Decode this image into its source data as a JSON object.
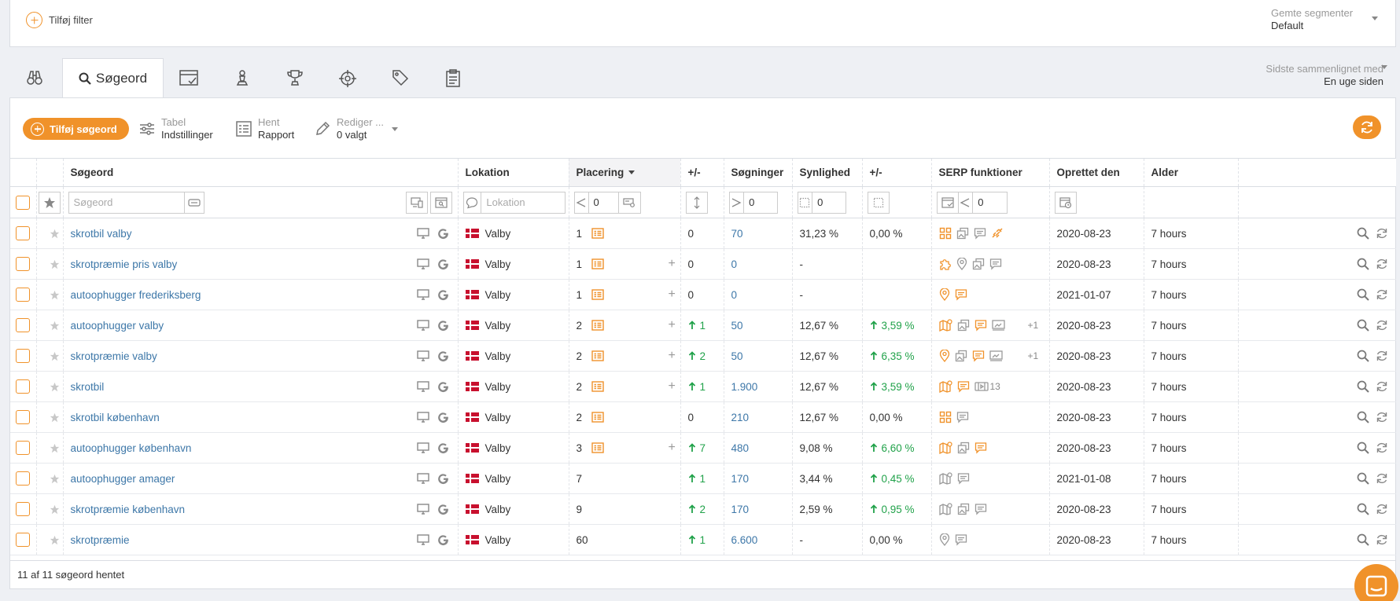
{
  "filterbar": {
    "add_filter_label": "Tilføj filter",
    "segments_label": "Gemte segmenter",
    "segments_value": "Default"
  },
  "tabs": {
    "active_label": "Søgeord",
    "compared_label": "Sidste sammenlignet med",
    "compared_value": "En uge siden"
  },
  "toolbar": {
    "add_keyword_label": "Tilføj søgeord",
    "table_label": "Tabel",
    "table_sub": "Indstillinger",
    "fetch_label": "Hent",
    "fetch_sub": "Rapport",
    "edit_label": "Rediger ...",
    "edit_sub": "0 valgt"
  },
  "columns": {
    "keyword": "Søgeord",
    "location": "Lokation",
    "position": "Placering",
    "pos_change": "+/-",
    "searches": "Søgninger",
    "visibility": "Synlighed",
    "vis_change": "+/-",
    "serp": "SERP funktioner",
    "created": "Oprettet den",
    "age": "Alder"
  },
  "filters": {
    "keyword_placeholder": "Søgeord",
    "location_placeholder": "Lokation",
    "position_value": "0",
    "searches_value": "0",
    "visibility_value": "0",
    "serp_value": "0"
  },
  "rows": [
    {
      "keyword": "skrotbil valby",
      "location": "Valby",
      "position": "1",
      "snippet": true,
      "plus": false,
      "change": "0",
      "change_up": false,
      "searches": "70",
      "visibility": "31,23 %",
      "vis_change": "0,00 %",
      "vis_up": false,
      "serp": [
        "grid",
        "images",
        "comment",
        "link"
      ],
      "serp_more": "",
      "created": "2020-08-23",
      "age": "7 hours"
    },
    {
      "keyword": "skrotpræmie pris valby",
      "location": "Valby",
      "position": "1",
      "snippet": true,
      "plus": true,
      "change": "0",
      "change_up": false,
      "searches": "0",
      "visibility": "-",
      "vis_change": "",
      "vis_up": false,
      "serp": [
        "puzzle",
        "pin",
        "images",
        "comment"
      ],
      "serp_more": "",
      "created": "2020-08-23",
      "age": "7 hours"
    },
    {
      "keyword": "autoophugger frederiksberg",
      "location": "Valby",
      "position": "1",
      "snippet": true,
      "plus": true,
      "change": "0",
      "change_up": false,
      "searches": "0",
      "visibility": "-",
      "vis_change": "",
      "vis_up": false,
      "serp": [
        "pin",
        "comment"
      ],
      "serp_more": "",
      "created": "2021-01-07",
      "age": "7 hours"
    },
    {
      "keyword": "autoophugger valby",
      "location": "Valby",
      "position": "2",
      "snippet": true,
      "plus": true,
      "change": "1",
      "change_up": true,
      "searches": "50",
      "visibility": "12,67 %",
      "vis_change": "3,59 %",
      "vis_up": true,
      "serp": [
        "map",
        "images",
        "comment",
        "screen"
      ],
      "serp_more": "+1",
      "created": "2020-08-23",
      "age": "7 hours"
    },
    {
      "keyword": "skrotpræmie valby",
      "location": "Valby",
      "position": "2",
      "snippet": true,
      "plus": true,
      "change": "2",
      "change_up": true,
      "searches": "50",
      "visibility": "12,67 %",
      "vis_change": "6,35 %",
      "vis_up": true,
      "serp": [
        "pin",
        "images",
        "comment",
        "screen"
      ],
      "serp_more": "+1",
      "created": "2020-08-23",
      "age": "7 hours"
    },
    {
      "keyword": "skrotbil",
      "location": "Valby",
      "position": "2",
      "snippet": true,
      "plus": true,
      "change": "1",
      "change_up": true,
      "searches": "1.900",
      "visibility": "12,67 %",
      "vis_change": "3,59 %",
      "vis_up": true,
      "serp": [
        "map",
        "comment",
        "video"
      ],
      "serp_more": "13",
      "created": "2020-08-23",
      "age": "7 hours"
    },
    {
      "keyword": "skrotbil københavn",
      "location": "Valby",
      "position": "2",
      "snippet": true,
      "plus": false,
      "change": "0",
      "change_up": false,
      "searches": "210",
      "visibility": "12,67 %",
      "vis_change": "0,00 %",
      "vis_up": false,
      "serp": [
        "grid",
        "comment"
      ],
      "serp_more": "",
      "created": "2020-08-23",
      "age": "7 hours"
    },
    {
      "keyword": "autoophugger københavn",
      "location": "Valby",
      "position": "3",
      "snippet": true,
      "plus": true,
      "change": "7",
      "change_up": true,
      "searches": "480",
      "visibility": "9,08 %",
      "vis_change": "6,60 %",
      "vis_up": true,
      "serp": [
        "map",
        "images",
        "comment"
      ],
      "serp_more": "",
      "created": "2020-08-23",
      "age": "7 hours"
    },
    {
      "keyword": "autoophugger amager",
      "location": "Valby",
      "position": "7",
      "snippet": false,
      "plus": false,
      "change": "1",
      "change_up": true,
      "searches": "170",
      "visibility": "3,44 %",
      "vis_change": "0,45 %",
      "vis_up": true,
      "serp": [
        "map",
        "comment"
      ],
      "serp_more": "",
      "created": "2021-01-08",
      "age": "7 hours"
    },
    {
      "keyword": "skrotpræmie københavn",
      "location": "Valby",
      "position": "9",
      "snippet": false,
      "plus": false,
      "change": "2",
      "change_up": true,
      "searches": "170",
      "visibility": "2,59 %",
      "vis_change": "0,95 %",
      "vis_up": true,
      "serp": [
        "map",
        "images",
        "comment"
      ],
      "serp_more": "",
      "created": "2020-08-23",
      "age": "7 hours"
    },
    {
      "keyword": "skrotpræmie",
      "location": "Valby",
      "position": "60",
      "snippet": false,
      "plus": false,
      "change": "1",
      "change_up": true,
      "searches": "6.600",
      "visibility": "-",
      "vis_change": "0,00 %",
      "vis_up": false,
      "serp": [
        "pin",
        "comment"
      ],
      "serp_more": "",
      "created": "2020-08-23",
      "age": "7 hours"
    }
  ],
  "footer": {
    "status": "11 af 11 søgeord hentet"
  },
  "colors": {
    "accent": "#f0922a",
    "link": "#3d77a8",
    "positive": "#21a24a"
  }
}
